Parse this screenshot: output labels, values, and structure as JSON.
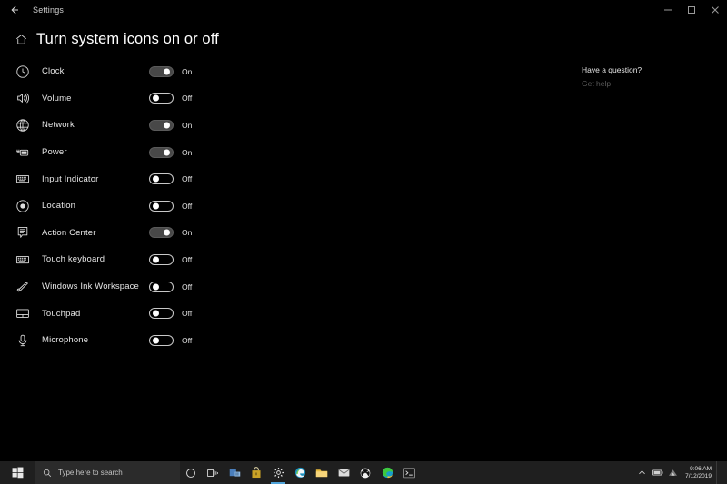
{
  "window": {
    "app_title": "Settings",
    "back_label": "←",
    "minimize_label": "─",
    "maximize_label": "□",
    "close_label": "✕"
  },
  "page": {
    "title": "Turn system icons on or off",
    "home_icon": "home-icon"
  },
  "settings": {
    "rows": [
      {
        "label": "Clock",
        "state": "On",
        "on": true,
        "icon": "clock-icon"
      },
      {
        "label": "Volume",
        "state": "Off",
        "on": false,
        "icon": "volume-icon"
      },
      {
        "label": "Network",
        "state": "On",
        "on": true,
        "icon": "network-icon"
      },
      {
        "label": "Power",
        "state": "On",
        "on": true,
        "icon": "power-icon"
      },
      {
        "label": "Input Indicator",
        "state": "Off",
        "on": false,
        "icon": "keyboard-icon"
      },
      {
        "label": "Location",
        "state": "Off",
        "on": false,
        "icon": "location-icon"
      },
      {
        "label": "Action Center",
        "state": "On",
        "on": true,
        "icon": "action-center-icon"
      },
      {
        "label": "Touch keyboard",
        "state": "Off",
        "on": false,
        "icon": "touch-keyboard-icon"
      },
      {
        "label": "Windows Ink Workspace",
        "state": "Off",
        "on": false,
        "icon": "pen-icon"
      },
      {
        "label": "Touchpad",
        "state": "Off",
        "on": false,
        "icon": "touchpad-icon"
      },
      {
        "label": "Microphone",
        "state": "Off",
        "on": false,
        "icon": "microphone-icon"
      }
    ]
  },
  "help": {
    "title": "Have a question?",
    "link": "Get help"
  },
  "taskbar": {
    "start_icon": "windows-logo-icon",
    "search_placeholder": "Type here to search",
    "search_icon": "search-icon",
    "apps": [
      {
        "name": "cortana-icon"
      },
      {
        "name": "task-view-icon"
      },
      {
        "name": "taskbar-pinned-app-icon"
      },
      {
        "name": "microsoft-store-icon"
      },
      {
        "name": "settings-gear-icon"
      },
      {
        "name": "edge-legacy-icon"
      },
      {
        "name": "file-explorer-icon"
      },
      {
        "name": "mail-icon"
      },
      {
        "name": "xbox-icon"
      },
      {
        "name": "edge-chromium-icon"
      },
      {
        "name": "terminal-icon"
      }
    ],
    "tray": [
      {
        "name": "show-hidden-icons-chevron"
      },
      {
        "name": "battery-icon"
      },
      {
        "name": "network-tray-icon"
      }
    ],
    "clock_time": "9:06 AM",
    "clock_date": "7/12/2019"
  },
  "colors": {
    "background": "#000000",
    "taskbar": "#1f1f1f",
    "accent": "#4fa3d9",
    "toggle_on_fill": "#484848",
    "text": "#e6e6e6",
    "muted": "#5a5a5a"
  }
}
